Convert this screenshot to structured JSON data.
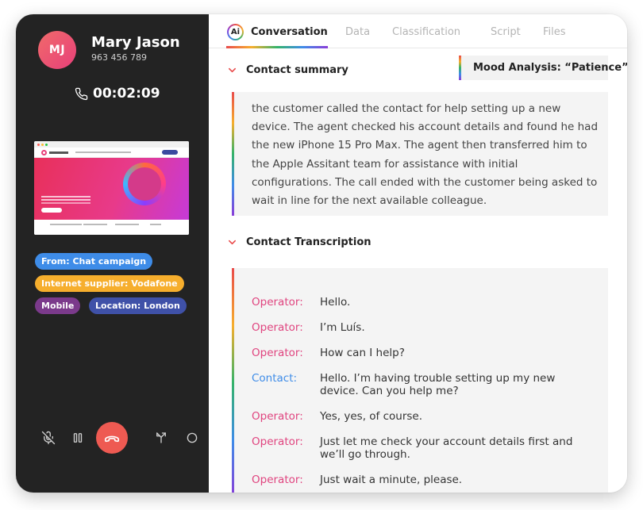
{
  "contact": {
    "initials": "MJ",
    "name": "Mary Jason",
    "phone": "963 456 789",
    "call_time": "00:02:09"
  },
  "tags": [
    {
      "label": "From: Chat campaign",
      "color": "#3e8ce8"
    },
    {
      "label": "Internet supplier: Vodafone",
      "color": "#f6ae2d"
    },
    {
      "label": "Mobile",
      "color": "#7b3a8b"
    },
    {
      "label": "Location: London",
      "color": "#3f51a8"
    }
  ],
  "tabs": {
    "ai_badge": "Ai",
    "conversation": "Conversation",
    "data": "Data",
    "classification": "Classification",
    "script": "Script",
    "files": "Files"
  },
  "mood": "Mood Analysis: “Patience”",
  "summary": {
    "title": "Contact summary",
    "text": "the customer called the contact for help setting up a new device. The agent checked his account details and found he had the new iPhone 15 Pro Max. The agent then transferred him to the Apple Assitant team for assistance with initial configurations. The call ended with the customer being asked to wait in line for the next available colleague."
  },
  "transcription": {
    "title": "Contact Transcription",
    "messages": [
      {
        "speaker": "Operator:",
        "text": "Hello."
      },
      {
        "speaker": "Operator:",
        "text": "I’m Luís."
      },
      {
        "speaker": "Operator:",
        "text": "How can I help?"
      },
      {
        "speaker": "Contact:",
        "text": "Hello. I’m having trouble setting up my new device. Can you help me?"
      },
      {
        "speaker": "Operator:",
        "text": "Yes, yes, of course."
      },
      {
        "speaker": "Operator:",
        "text": "Just let me check your account details first and we’ll go through."
      },
      {
        "speaker": "Operator:",
        "text": "Just wait a minute, please."
      }
    ]
  },
  "colors": {
    "panel": "#232323",
    "accent_pink": "#e0447f",
    "accent_blue": "#3e8ce8",
    "hangup": "#ee5a52"
  },
  "icons": [
    "phone-icon",
    "mute-icon",
    "pause-icon",
    "hangup-icon",
    "transfer-icon",
    "record-icon",
    "chevron-down-icon"
  ]
}
